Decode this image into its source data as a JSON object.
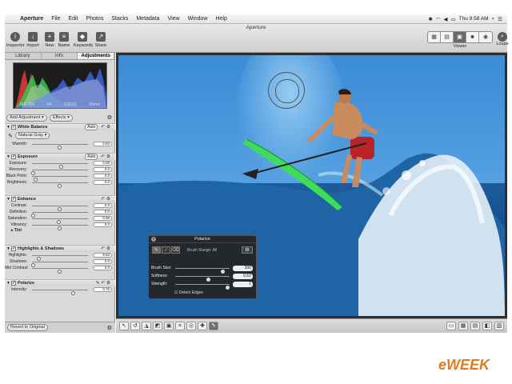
{
  "menubar": {
    "items": [
      "Aperture",
      "File",
      "Edit",
      "Photos",
      "Stacks",
      "Metadata",
      "View",
      "Window",
      "Help"
    ],
    "clock": "Thu 9:58 AM"
  },
  "window": {
    "title": "Aperture"
  },
  "toolbar": {
    "inspector": "Inspector",
    "import": "Import",
    "new": "New",
    "name": "Name",
    "keywords": "Keywords",
    "share": "Share",
    "viewer": "Viewer",
    "loupe": "Loupe"
  },
  "inspector": {
    "tabs": [
      "Library",
      "Info",
      "Adjustments"
    ],
    "active_tab": "Adjustments",
    "histogram_info": [
      "ISO 200",
      "f/4",
      "1/2000",
      "55mm"
    ],
    "add_adjustment": "Add Adjustment",
    "effects": "Effects",
    "white_balance": {
      "title": "White Balance",
      "auto": "Auto",
      "preset": "Natural Gray",
      "warmth_label": "Warmth:",
      "warmth_value": "0.50",
      "warmth_level": 0.5
    },
    "exposure": {
      "title": "Exposure",
      "auto": "Auto",
      "rows": [
        {
          "label": "Exposure:",
          "value": "0.08",
          "level": 0.53
        },
        {
          "label": "Recovery:",
          "value": "0.0",
          "level": 0.0
        },
        {
          "label": "Black Point:",
          "value": "0.0",
          "level": 0.05
        },
        {
          "label": "Brightness:",
          "value": "0.0",
          "level": 0.5
        }
      ]
    },
    "enhance": {
      "title": "Enhance",
      "rows": [
        {
          "label": "Contrast:",
          "value": "0.0",
          "level": 0.5
        },
        {
          "label": "Definition:",
          "value": "0.0",
          "level": 0.0
        },
        {
          "label": "Saturation:",
          "value": "0.98",
          "level": 0.49
        },
        {
          "label": "Vibrancy:",
          "value": "0.0",
          "level": 0.5
        }
      ],
      "tint": "Tint"
    },
    "highlights_shadows": {
      "title": "Highlights & Shadows",
      "rows": [
        {
          "label": "Highlights:",
          "value": "9.53",
          "level": 0.1
        },
        {
          "label": "Shadows:",
          "value": "0.0",
          "level": 0.0
        },
        {
          "label": "Mid Contrast:",
          "value": "0.0",
          "level": 0.5
        }
      ]
    },
    "polarize": {
      "title": "Polarize",
      "rows": [
        {
          "label": "Intensity:",
          "value": "0.75",
          "level": 0.75
        }
      ]
    },
    "revert": "Revert to Original"
  },
  "hud": {
    "title": "Polarize",
    "brush_range": "Brush Range: All",
    "rows": [
      {
        "label": "Brush Size:",
        "value": "200",
        "level": 0.9
      },
      {
        "label": "Softness:",
        "value": "0.62",
        "level": 0.62
      },
      {
        "label": "Strength:",
        "value": "1",
        "level": 1.0
      }
    ],
    "detect_edges": "Detect Edges"
  },
  "watermark": "eWEEK"
}
